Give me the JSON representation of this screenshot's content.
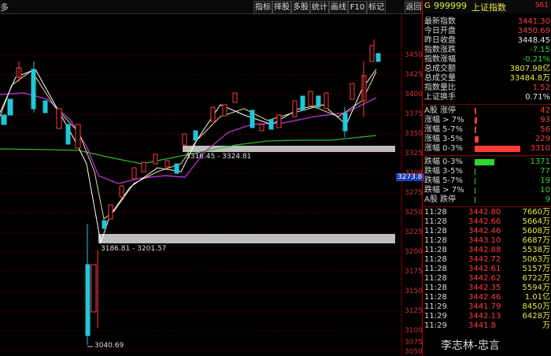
{
  "toolbar": {
    "symbol": "多",
    "buttons": [
      "指标",
      "择股",
      "多股",
      "统计",
      "画线",
      "F10",
      "标记",
      "返回"
    ]
  },
  "chart": {
    "yaxis": [
      "3450",
      "3425",
      "3400",
      "3375",
      "3350",
      "3325",
      "3300",
      "3275",
      "3250",
      "3225",
      "3200",
      "3175",
      "3150",
      "3125",
      "3100",
      "3075",
      "3050"
    ],
    "current_price_label": "3273.8",
    "annotations": {
      "box1": "3316.45 - 3324.81",
      "box2": "3186.81 - 3201.57",
      "low": "3040.69"
    }
  },
  "panel": {
    "header": {
      "code": "999999",
      "name": "上证指数",
      "badge": "G",
      "tail": "S61"
    },
    "stats": [
      {
        "label": "最新指数",
        "value": "3441.30",
        "color": "red"
      },
      {
        "label": "今日开盘",
        "value": "3450.69",
        "color": "red"
      },
      {
        "label": "昨日收盘",
        "value": "3448.45",
        "color": "wht"
      },
      {
        "label": "指数涨跌",
        "value": "-7.15",
        "color": "grn"
      },
      {
        "label": "指数涨幅",
        "value": "-0.21%",
        "color": "grn"
      },
      {
        "label": "总成交额",
        "value": "3807.98亿",
        "color": "yel"
      },
      {
        "label": "总成交量",
        "value": "33484.8万",
        "color": "yel"
      },
      {
        "label": "指数量比",
        "value": "1.52",
        "color": "red"
      },
      {
        "label": "上证换手",
        "value": "0.71%",
        "color": "wht"
      }
    ],
    "breadth_up": [
      {
        "label": "A股 涨停",
        "value": "42",
        "bar": 0.01
      },
      {
        "label": "涨幅 > 7%",
        "value": "93",
        "bar": 0.02
      },
      {
        "label": "涨幅 5-7%",
        "value": "56",
        "bar": 0.015
      },
      {
        "label": "涨幅 3-5%",
        "value": "229",
        "bar": 0.05
      },
      {
        "label": "涨幅 0-3%",
        "value": "3310",
        "bar": 1.0
      }
    ],
    "breadth_down": [
      {
        "label": "跌幅 0-3%",
        "value": "1371",
        "bar": 0.42
      },
      {
        "label": "跌幅 3-5%",
        "value": "77",
        "bar": 0.02
      },
      {
        "label": "跌幅 5-7%",
        "value": "19",
        "bar": 0.01
      },
      {
        "label": "跌幅 > 7%",
        "value": "10",
        "bar": 0.01
      },
      {
        "label": "A股 跌停",
        "value": "9",
        "bar": 0.01
      }
    ],
    "ticks": [
      {
        "time": "11:28",
        "price": "3442.80",
        "vol": "7660万"
      },
      {
        "time": "11:28",
        "price": "3442.66",
        "vol": "5664万"
      },
      {
        "time": "11:28",
        "price": "3442.46",
        "vol": "5608万"
      },
      {
        "time": "11:28",
        "price": "3443.10",
        "vol": "6687万"
      },
      {
        "time": "11:28",
        "price": "3442.88",
        "vol": "5538万"
      },
      {
        "time": "11:28",
        "price": "3442.72",
        "vol": "5063万"
      },
      {
        "time": "11:28",
        "price": "3442.61",
        "vol": "5157万"
      },
      {
        "time": "11:28",
        "price": "3442.62",
        "vol": "6722万"
      },
      {
        "time": "11:28",
        "price": "3442.35",
        "vol": "5594万"
      },
      {
        "time": "11:28",
        "price": "3442.46",
        "vol": "1.01亿"
      },
      {
        "time": "11:29",
        "price": "3441.79",
        "vol": "8450万"
      },
      {
        "time": "11:29",
        "price": "3442.13",
        "vol": "6428万"
      },
      {
        "time": "11:29",
        "price": "3441.8",
        "vol": "万"
      }
    ]
  },
  "watermark": "李志林-忠言",
  "colors": {
    "up": "#ff3b3b",
    "down": "#32d632",
    "accent": "#cc0000"
  }
}
